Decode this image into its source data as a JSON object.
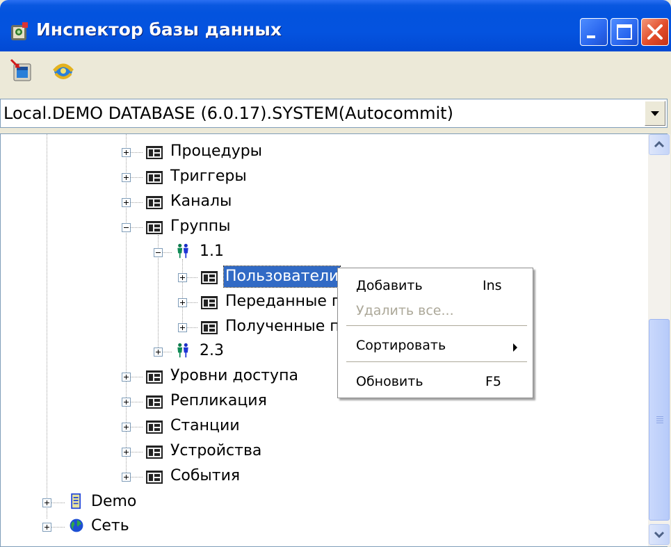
{
  "window": {
    "title": "Инспектор базы данных",
    "title_icon": "database-inspector-icon"
  },
  "toolbar": {
    "buttons": [
      {
        "icon": "add-connection-icon"
      },
      {
        "icon": "refresh-connection-icon"
      }
    ]
  },
  "connection_combo": {
    "value": "Local.DEMO DATABASE (6.0.17).SYSTEM(Autocommit)"
  },
  "tree": {
    "nodes": [
      {
        "label": "Процедуры",
        "icon": "folder-table-icon",
        "expanded": false
      },
      {
        "label": "Триггеры",
        "icon": "folder-table-icon",
        "expanded": false
      },
      {
        "label": "Каналы",
        "icon": "folder-table-icon",
        "expanded": false
      },
      {
        "label": "Группы",
        "icon": "folder-table-icon",
        "expanded": true
      },
      {
        "label": "1.1",
        "icon": "users-group-icon",
        "expanded": true
      },
      {
        "label": "Пользователи",
        "icon": "folder-table-icon",
        "expanded": false,
        "selected": true
      },
      {
        "label": "Переданные п",
        "icon": "folder-table-icon",
        "expanded": false
      },
      {
        "label": "Полученные п",
        "icon": "folder-table-icon",
        "expanded": false
      },
      {
        "label": "2.3",
        "icon": "users-group-icon",
        "expanded": false
      },
      {
        "label": "Уровни доступа",
        "icon": "folder-table-icon",
        "expanded": false
      },
      {
        "label": "Репликация",
        "icon": "folder-table-icon",
        "expanded": false
      },
      {
        "label": "Станции",
        "icon": "folder-table-icon",
        "expanded": false
      },
      {
        "label": "Устройства",
        "icon": "folder-table-icon",
        "expanded": false
      },
      {
        "label": "События",
        "icon": "folder-table-icon",
        "expanded": false
      },
      {
        "label": "Demo",
        "icon": "database-icon",
        "expanded": false
      },
      {
        "label": "Сеть",
        "icon": "network-globe-icon",
        "expanded": false
      }
    ]
  },
  "context_menu": {
    "items": [
      {
        "label": "Добавить",
        "shortcut": "Ins",
        "enabled": true
      },
      {
        "label": "Удалить все...",
        "shortcut": "",
        "enabled": false
      },
      {
        "label": "Сортировать",
        "submenu": true,
        "enabled": true
      },
      {
        "label": "Обновить",
        "shortcut": "F5",
        "enabled": true
      }
    ]
  },
  "colors": {
    "titlebar": "#0453df",
    "selection": "#316ac5",
    "window_bg": "#ece9d8"
  }
}
